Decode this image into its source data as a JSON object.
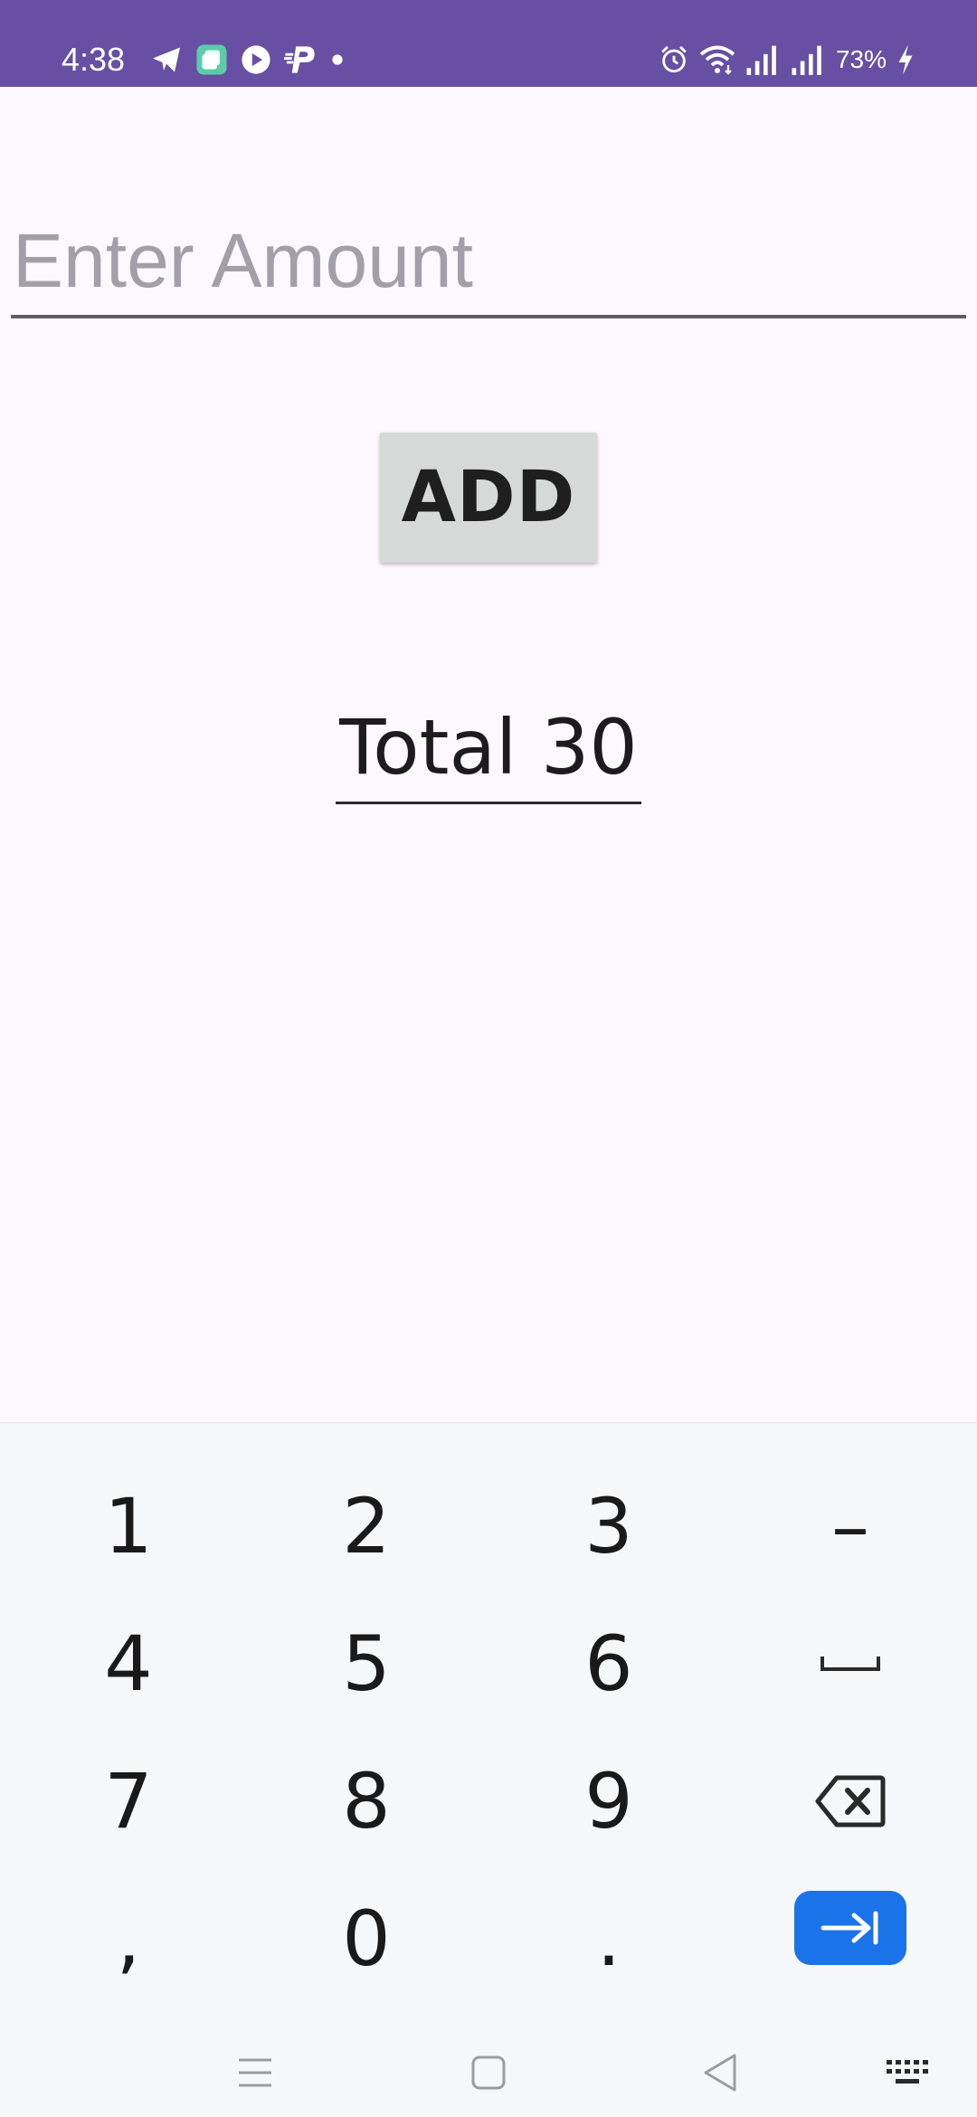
{
  "status_bar": {
    "time": "4:38",
    "battery": "73%",
    "background": "#6750a4",
    "left_icons": [
      "telegram-icon",
      "app-icon",
      "play-icon",
      "paypal-icon",
      "dot-icon"
    ],
    "right_icons": [
      "alarm-icon",
      "wifi-icon",
      "signal-icon",
      "signal-icon",
      "charging-icon"
    ]
  },
  "form": {
    "amount_placeholder": "Enter Amount",
    "amount_value": "",
    "add_label": "ADD",
    "total_text": "Total 30"
  },
  "keyboard": {
    "rows": [
      [
        "1",
        "2",
        "3",
        "–"
      ],
      [
        "4",
        "5",
        "6",
        "space-icon"
      ],
      [
        "7",
        "8",
        "9",
        "backspace-icon"
      ],
      [
        ",",
        "0",
        ".",
        "next-icon"
      ]
    ],
    "accent": "#1a73e8",
    "nav_icons": [
      "menu-icon",
      "home-icon",
      "back-icon",
      "keyboard-icon"
    ]
  }
}
